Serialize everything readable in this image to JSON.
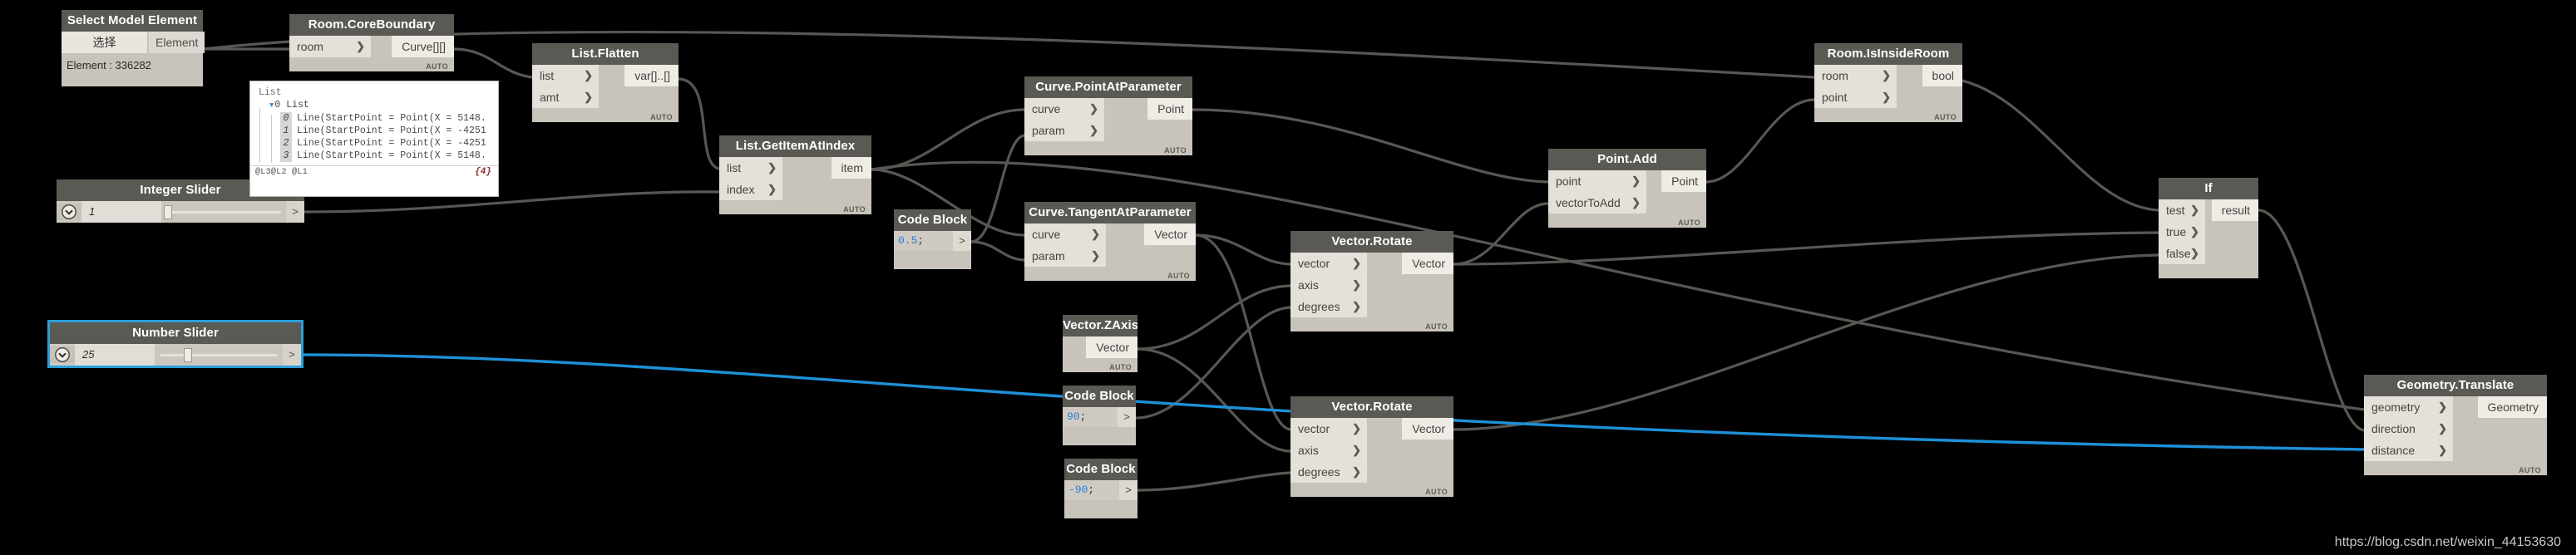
{
  "watermark": "https://blog.csdn.net/weixin_44153630",
  "colors": {
    "canvas_background": "#000000",
    "node_body": "#c8c4bb",
    "node_header": "#5b5954",
    "port_background": "#e4e1da",
    "selection_accent": "#2a9fd8",
    "wire_default": "#5a5854",
    "wire_selected": "#1e90d8",
    "code_number": "#2a7fd4"
  },
  "nodes": {
    "select_model_element": {
      "title": "Select Model Element",
      "button_label": "选择",
      "output_label": "Element",
      "status_text": "Element : 336282"
    },
    "room_core_boundary": {
      "title": "Room.CoreBoundary",
      "inputs": [
        "room"
      ],
      "outputs": [
        "Curve[][]"
      ],
      "run_mode": "AUTO"
    },
    "list_preview": {
      "root_label": "List",
      "branch_label": "0 List",
      "items": [
        {
          "index": "0",
          "text": "Line(StartPoint = Point(X = 5148."
        },
        {
          "index": "1",
          "text": "Line(StartPoint = Point(X = -4251"
        },
        {
          "index": "2",
          "text": "Line(StartPoint = Point(X = -4251"
        },
        {
          "index": "3",
          "text": "Line(StartPoint = Point(X = 5148."
        }
      ],
      "levels": "@L3@L2 @L1",
      "count": "{4}"
    },
    "list_flatten": {
      "title": "List.Flatten",
      "inputs": [
        "list",
        "amt"
      ],
      "outputs": [
        "var[]..[]"
      ],
      "run_mode": "AUTO"
    },
    "integer_slider": {
      "title": "Integer Slider",
      "value": "1",
      "output_label": ">",
      "thumb_percent": 2
    },
    "number_slider": {
      "title": "Number Slider",
      "value": "25",
      "output_label": ">",
      "thumb_percent": 25,
      "selected": true
    },
    "list_get_item_at_index": {
      "title": "List.GetItemAtIndex",
      "inputs": [
        "list",
        "index"
      ],
      "outputs": [
        "item"
      ],
      "run_mode": "AUTO"
    },
    "code_block_half": {
      "title": "Code Block",
      "code_value": "0.5",
      "code_terminator": ";",
      "output_label": ">"
    },
    "code_block_90": {
      "title": "Code Block",
      "code_value": "90",
      "code_terminator": ";",
      "output_label": ">"
    },
    "code_block_neg90": {
      "title": "Code Block",
      "code_value": "-90",
      "code_terminator": ";",
      "output_label": ">"
    },
    "curve_point_at_parameter": {
      "title": "Curve.PointAtParameter",
      "inputs": [
        "curve",
        "param"
      ],
      "outputs": [
        "Point"
      ],
      "run_mode": "AUTO"
    },
    "curve_tangent_at_parameter": {
      "title": "Curve.TangentAtParameter",
      "inputs": [
        "curve",
        "param"
      ],
      "outputs": [
        "Vector"
      ],
      "run_mode": "AUTO"
    },
    "vector_zaxis": {
      "title": "Vector.ZAxis",
      "outputs": [
        "Vector"
      ],
      "run_mode": "AUTO"
    },
    "vector_rotate_top": {
      "title": "Vector.Rotate",
      "inputs": [
        "vector",
        "axis",
        "degrees"
      ],
      "outputs": [
        "Vector"
      ],
      "run_mode": "AUTO"
    },
    "vector_rotate_bottom": {
      "title": "Vector.Rotate",
      "inputs": [
        "vector",
        "axis",
        "degrees"
      ],
      "outputs": [
        "Vector"
      ],
      "run_mode": "AUTO"
    },
    "point_add": {
      "title": "Point.Add",
      "inputs": [
        "point",
        "vectorToAdd"
      ],
      "outputs": [
        "Point"
      ],
      "run_mode": "AUTO"
    },
    "room_is_inside_room": {
      "title": "Room.IsInsideRoom",
      "inputs": [
        "room",
        "point"
      ],
      "outputs": [
        "bool"
      ],
      "run_mode": "AUTO"
    },
    "if_node": {
      "title": "If",
      "inputs": [
        "test",
        "true",
        "false"
      ],
      "outputs": [
        "result"
      ]
    },
    "geometry_translate": {
      "title": "Geometry.Translate",
      "inputs": [
        "geometry",
        "direction",
        "distance"
      ],
      "outputs": [
        "Geometry"
      ],
      "run_mode": "AUTO"
    }
  }
}
